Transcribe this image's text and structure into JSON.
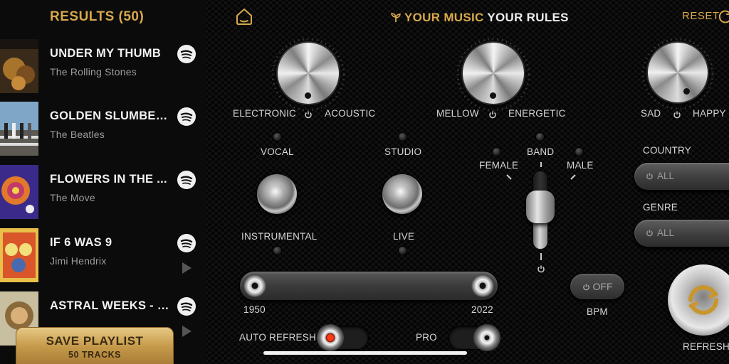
{
  "sidebar": {
    "title": "RESULTS (50)",
    "tracks": [
      {
        "title": "UNDER MY THUMB",
        "artist": "The Rolling Stones",
        "service_icon": "spotify-icon"
      },
      {
        "title": "GOLDEN SLUMBER...",
        "artist": "The Beatles",
        "service_icon": "spotify-icon"
      },
      {
        "title": "FLOWERS IN THE ...",
        "artist": "The Move",
        "service_icon": "spotify-icon"
      },
      {
        "title": "IF 6 WAS 9",
        "artist": "Jimi Hendrix",
        "service_icon": "spotify-icon"
      },
      {
        "title": "ASTRAL WEEKS - 1...",
        "artist": "",
        "service_icon": "spotify-icon"
      }
    ],
    "save_playlist": {
      "label": "SAVE PLAYLIST",
      "count": "50 TRACKS"
    }
  },
  "header": {
    "title_accent": "YOUR MUSIC",
    "title_rest": "YOUR RULES",
    "reset_label": "RESET"
  },
  "controls": {
    "knob1": {
      "left": "ELECTRONIC",
      "right": "ACOUSTIC"
    },
    "knob2": {
      "left": "MELLOW",
      "right": "ENERGETIC"
    },
    "knob3": {
      "left": "SAD",
      "right": "HAPPY"
    },
    "vocal_label": "VOCAL",
    "instrumental_label": "INSTRUMENTAL",
    "studio_label": "STUDIO",
    "live_label": "LIVE",
    "band_label": "BAND",
    "female_label": "FEMALE",
    "male_label": "MALE",
    "year_min": "1950",
    "year_max": "2022",
    "bpm_value": "OFF",
    "bpm_label": "BPM",
    "auto_refresh_label": "AUTO REFRESH",
    "pro_label": "PRO",
    "country_label": "COUNTRY",
    "country_value": "ALL",
    "genre_label": "GENRE",
    "genre_value": "ALL",
    "refresh_label": "REFRESH"
  },
  "colors": {
    "accent": "#d8a84c",
    "background": "#0a0a0a"
  }
}
